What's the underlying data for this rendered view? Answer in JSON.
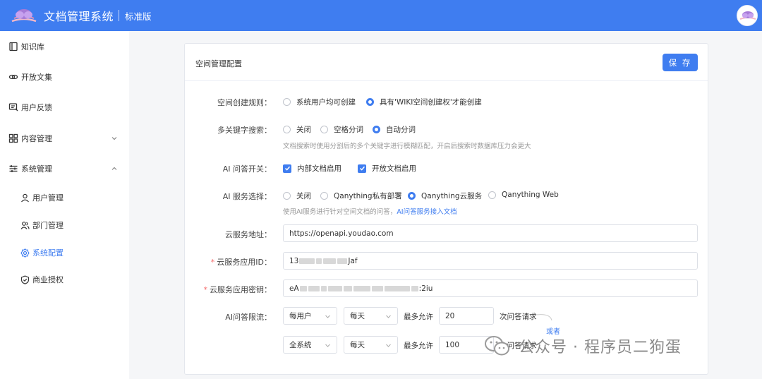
{
  "header": {
    "app_title": "文档管理系统",
    "edition": "标准版"
  },
  "sidebar": {
    "items": [
      {
        "label": "知识库"
      },
      {
        "label": "开放文集"
      },
      {
        "label": "用户反馈"
      },
      {
        "label": "内容管理"
      },
      {
        "label": "系统管理"
      }
    ],
    "sub_items": [
      {
        "label": "用户管理"
      },
      {
        "label": "部门管理"
      },
      {
        "label": "系统配置"
      },
      {
        "label": "商业授权"
      }
    ]
  },
  "card": {
    "title": "空间管理配置",
    "save_label": "保 存"
  },
  "form": {
    "space_rule": {
      "label": "空间创建规则：",
      "options": [
        "系统用户均可创建",
        "具有'WIKI空间创建权'才能创建"
      ],
      "selected": "具有'WIKI空间创建权'才能创建"
    },
    "keyword_search": {
      "label": "多关键字搜索：",
      "options": [
        "关闭",
        "空格分词",
        "自动分词"
      ],
      "selected": "自动分词",
      "hint": "文档搜索时使用分割后的多个关键字进行模糊匹配，开启后搜索时数据库压力会更大"
    },
    "ai_qa_switch": {
      "label": "AI 问答开关：",
      "options": [
        "内部文档启用",
        "开放文档启用"
      ]
    },
    "ai_service": {
      "label": "AI 服务选择：",
      "options": [
        "关闭",
        "Qanything私有部署",
        "Qanything云服务",
        "Qanything Web"
      ],
      "selected": "Qanything云服务",
      "hint_prefix": "使用AI服务进行针对空间文档的问答，",
      "hint_link": "AI问答服务接入文档"
    },
    "cloud_url": {
      "label": "云服务地址：",
      "value": "https://openapi.youdao.com"
    },
    "app_id": {
      "label": "云服务应用ID：",
      "value_start": "13",
      "value_end": "Jaf"
    },
    "app_secret": {
      "label": "云服务应用密钥：",
      "value_start": "eA",
      "value_end": ":2iu"
    },
    "rate_limit": {
      "label": "AI问答限流：",
      "row1": {
        "scope": "每用户",
        "period": "每天",
        "max_label": "最多允许",
        "count": "20",
        "suffix": "次问答请求"
      },
      "or_label": "或者",
      "row2": {
        "scope": "全系统",
        "period": "每天",
        "max_label": "最多允许",
        "count": "100",
        "suffix": "次问答请求"
      }
    }
  },
  "watermark": {
    "text": "公众号 · 程序员二狗蛋"
  }
}
